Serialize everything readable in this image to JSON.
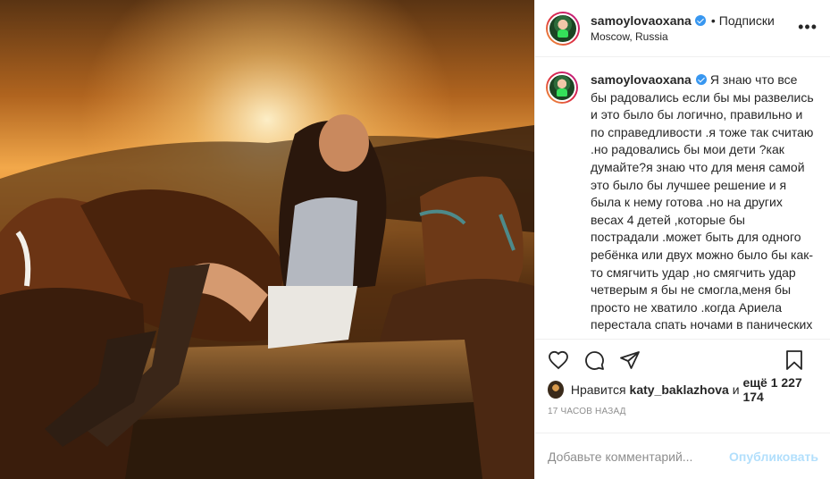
{
  "post": {
    "username": "samoylovaoxana",
    "separator": "•",
    "follow_label": "Подписки",
    "location": "Moscow, Russia",
    "more_label": "•••"
  },
  "caption": {
    "username": "samoylovaoxana",
    "text": "Я знаю что все бы радовались если бы мы развелись и это было бы логично, правильно и по справедливости .я тоже так считаю .но радовались бы мои дети ?как думайте?я знаю что для меня самой это было бы лучшее решение и я была к нему готова .но на других весах 4 детей ,которые бы пострадали .может быть для одного ребёнка или двух можно было бы как-то смягчить удар ,но смягчить удар четверым я бы не смогла,меня бы просто не хватило .когда Ариела перестала спать ночами в панических атаках и задыхаясь .я резко испугалась ,но я испугались"
  },
  "likes": {
    "prefix": "Нравится",
    "user": "katy_baklazhova",
    "middle": "и",
    "count": "ещё 1 227 174"
  },
  "timestamp": "17 часов назад",
  "comment": {
    "placeholder": "Добавьте комментарий...",
    "publish_label": "Опубликовать"
  },
  "icons": {
    "like": "heart-icon",
    "comment": "comment-icon",
    "share": "paper-plane-icon",
    "save": "bookmark-icon",
    "verified": "verified-badge-icon"
  },
  "colors": {
    "verified": "#3897f0",
    "publish_disabled": "#b2dffc",
    "muted": "#8e8e8e"
  }
}
